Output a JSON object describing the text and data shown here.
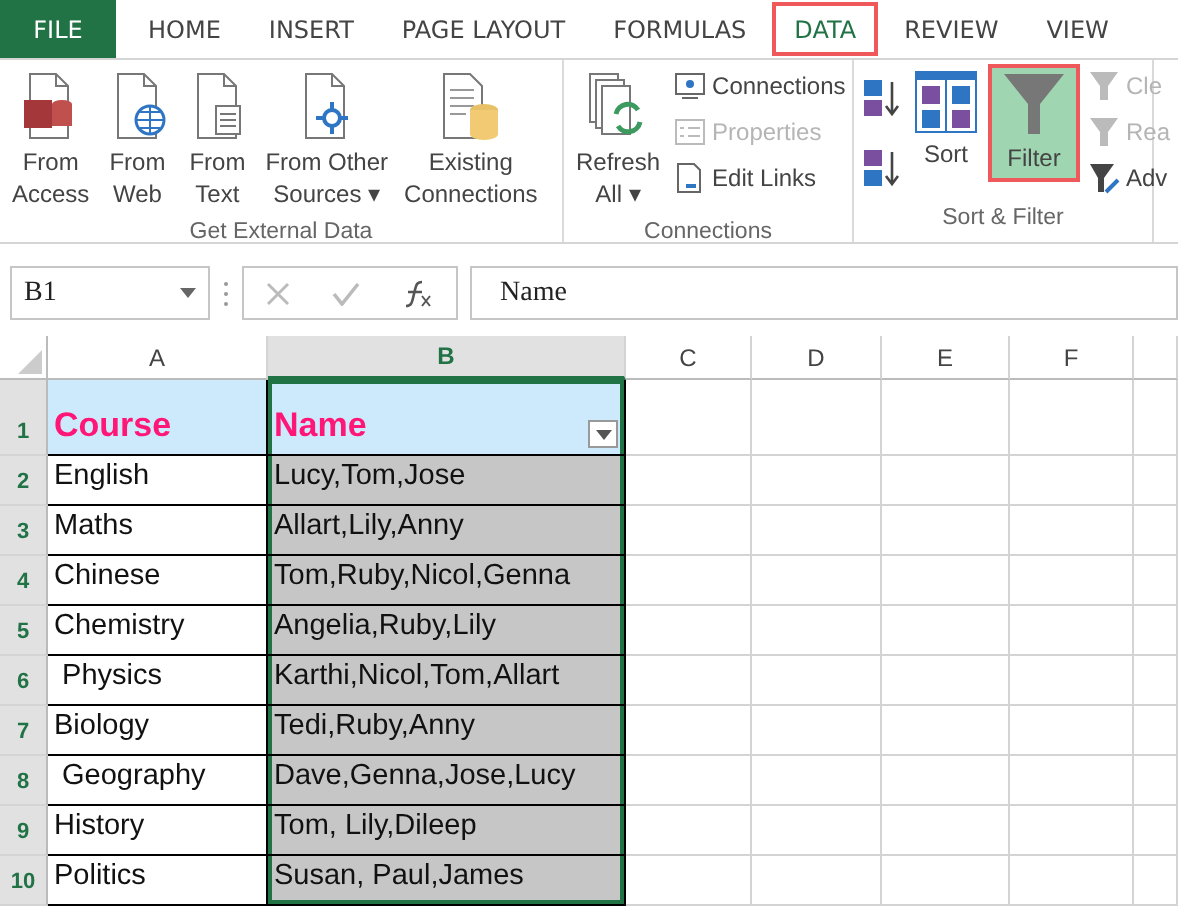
{
  "tabs": [
    {
      "label": "FILE",
      "kind": "file",
      "selected": false
    },
    {
      "label": "HOME",
      "kind": "tab",
      "selected": false
    },
    {
      "label": "INSERT",
      "kind": "tab",
      "selected": false
    },
    {
      "label": "PAGE LAYOUT",
      "kind": "tab",
      "selected": false
    },
    {
      "label": "FORMULAS",
      "kind": "tab",
      "selected": false
    },
    {
      "label": "DATA",
      "kind": "tab",
      "selected": true
    },
    {
      "label": "REVIEW",
      "kind": "tab",
      "selected": false
    },
    {
      "label": "VIEW",
      "kind": "tab",
      "selected": false
    }
  ],
  "ribbon_groups": [
    {
      "title": "Get External Data",
      "columns": [
        [
          {
            "kind": "large",
            "lines": [
              "From",
              "Access"
            ]
          }
        ],
        [
          {
            "kind": "large",
            "lines": [
              "From",
              "Web"
            ]
          }
        ],
        [
          {
            "kind": "large",
            "lines": [
              "From",
              "Text"
            ]
          }
        ],
        [
          {
            "kind": "large",
            "lines": [
              "From Other",
              "Sources ▾"
            ]
          }
        ],
        [
          {
            "kind": "large",
            "lines": [
              "Existing",
              "Connections"
            ]
          }
        ]
      ]
    },
    {
      "title": "Connections",
      "columns": [
        [
          {
            "kind": "large",
            "lines": [
              "Refresh",
              "All ▾"
            ]
          }
        ],
        [
          {
            "kind": "small",
            "lines": [
              "Connections"
            ],
            "disabled": false
          },
          {
            "kind": "small",
            "lines": [
              "Properties"
            ],
            "disabled": true
          },
          {
            "kind": "small",
            "lines": [
              "Edit Links"
            ],
            "disabled": false
          }
        ]
      ]
    },
    {
      "title": "Sort & Filter",
      "columns": [
        [
          {
            "kind": "icon"
          },
          {
            "kind": "icon"
          }
        ],
        [
          {
            "kind": "large",
            "lines": [
              "Sort"
            ],
            "active": false
          }
        ],
        [
          {
            "kind": "large",
            "lines": [
              "Filter"
            ],
            "active": true
          }
        ],
        [
          {
            "kind": "small",
            "lines": [
              "Cle"
            ],
            "disabled": true
          },
          {
            "kind": "small",
            "lines": [
              "Rea"
            ],
            "disabled": true
          },
          {
            "kind": "small",
            "lines": [
              "Adv"
            ],
            "disabled": false
          }
        ]
      ]
    }
  ],
  "formula_bar": {
    "name_box": "B1",
    "formula": "Name"
  },
  "columns": [
    {
      "label": "A",
      "selected": false
    },
    {
      "label": "B",
      "selected": true
    },
    {
      "label": "C",
      "selected": false
    },
    {
      "label": "D",
      "selected": false
    },
    {
      "label": "E",
      "selected": false
    },
    {
      "label": "F",
      "selected": false
    }
  ],
  "rows": [
    {
      "number": "1",
      "selected": true,
      "kind": "header",
      "filter_button": true,
      "cells": [
        "Course",
        "Name"
      ]
    },
    {
      "number": "2",
      "selected": true,
      "kind": "data",
      "cells": [
        "English",
        "Lucy,Tom,Jose"
      ]
    },
    {
      "number": "3",
      "selected": true,
      "kind": "data",
      "cells": [
        "Maths",
        "Allart,Lily,Anny"
      ]
    },
    {
      "number": "4",
      "selected": true,
      "kind": "data",
      "cells": [
        "Chinese",
        "Tom,Ruby,Nicol,Genna"
      ]
    },
    {
      "number": "5",
      "selected": true,
      "kind": "data",
      "cells": [
        "Chemistry",
        "Angelia,Ruby,Lily"
      ]
    },
    {
      "number": "6",
      "selected": true,
      "kind": "data",
      "cells": [
        " Physics",
        "Karthi,Nicol,Tom,Allart"
      ]
    },
    {
      "number": "7",
      "selected": true,
      "kind": "data",
      "cells": [
        "Biology",
        "Tedi,Ruby,Anny"
      ]
    },
    {
      "number": "8",
      "selected": true,
      "kind": "data",
      "cells": [
        " Geography",
        "Dave,Genna,Jose,Lucy"
      ]
    },
    {
      "number": "9",
      "selected": true,
      "kind": "data",
      "cells": [
        "History",
        "Tom, Lily,Dileep"
      ]
    },
    {
      "number": "10",
      "selected": true,
      "kind": "data",
      "cells": [
        "Politics",
        "Susan, Paul,James"
      ]
    }
  ]
}
